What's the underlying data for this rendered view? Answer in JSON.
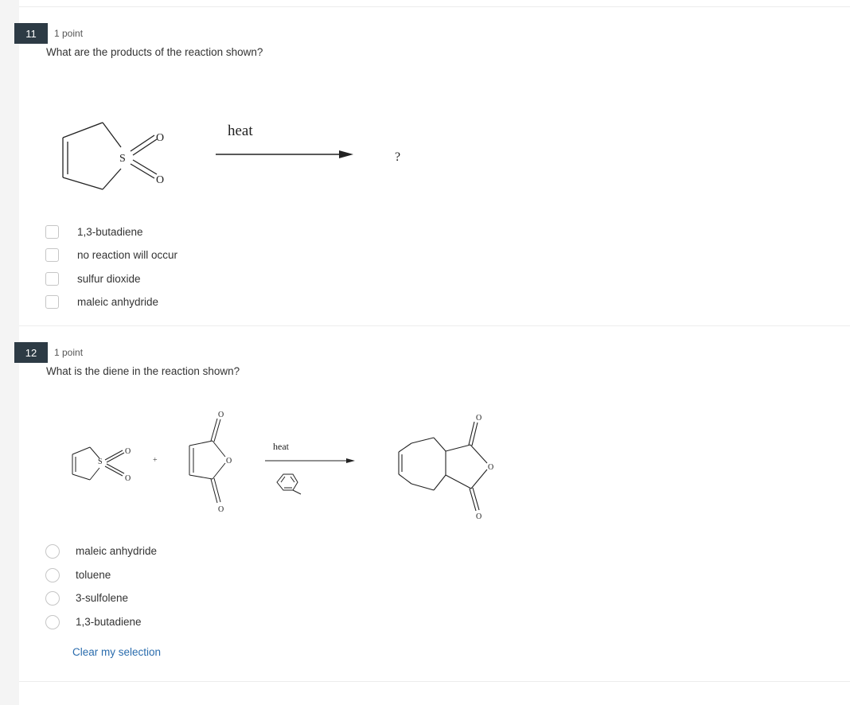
{
  "questions": [
    {
      "number": "11",
      "points": "1 point",
      "prompt": "What are the products of the reaction shown?",
      "input_type": "checkbox",
      "figure": {
        "reactant_atoms": {
          "S": "S",
          "O1": "O",
          "O2": "O"
        },
        "arrow_label": "heat",
        "product": "?"
      },
      "options": [
        "1,3-butadiene",
        "no reaction will occur",
        "sulfur dioxide",
        "maleic anhydride"
      ]
    },
    {
      "number": "12",
      "points": "1 point",
      "prompt": "What is the diene in the reaction shown?",
      "input_type": "radio",
      "figure": {
        "sulfolene_atoms": {
          "S": "S",
          "O1": "O",
          "O2": "O"
        },
        "plus": "+",
        "anhydride_atoms": {
          "Otop": "O",
          "Oring": "O",
          "Obottom": "O"
        },
        "arrow_label": "heat",
        "product_atoms": {
          "Otop": "O",
          "Oring": "O",
          "Obottom": "O"
        }
      },
      "options": [
        "maleic anhydride",
        "toluene",
        "3-sulfolene",
        "1,3-butadiene"
      ],
      "clear_label": "Clear my selection"
    }
  ]
}
